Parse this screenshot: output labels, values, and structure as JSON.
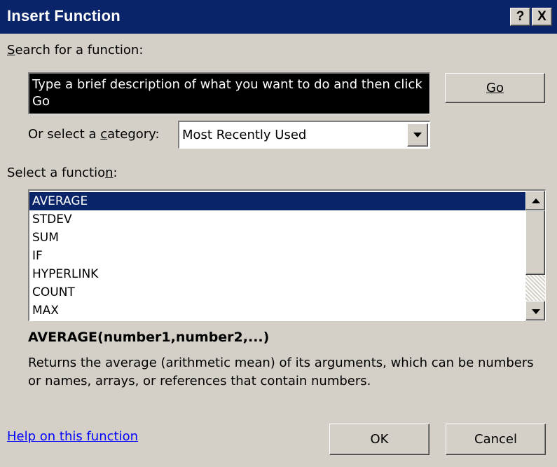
{
  "window": {
    "title": "Insert Function",
    "help_button": "?",
    "close_button": "X"
  },
  "search": {
    "label_prefix": "",
    "label_accel": "S",
    "label_rest": "earch for a function:",
    "value": "Type a brief description of what you want to do and then click Go",
    "go_label": "Go"
  },
  "category": {
    "label_prefix": "Or select a ",
    "label_accel": "c",
    "label_rest": "ategory:",
    "selected": "Most Recently Used"
  },
  "functions": {
    "label_prefix": "Select a functio",
    "label_accel": "n",
    "label_rest": ":",
    "items": [
      {
        "name": "AVERAGE"
      },
      {
        "name": "STDEV"
      },
      {
        "name": "SUM"
      },
      {
        "name": "IF"
      },
      {
        "name": "HYPERLINK"
      },
      {
        "name": "COUNT"
      },
      {
        "name": "MAX"
      }
    ],
    "selected_index": 0
  },
  "details": {
    "syntax": "AVERAGE(number1,number2,...)",
    "description": "Returns the average (arithmetic mean) of its arguments, which can be numbers or names, arrays, or references that contain numbers."
  },
  "footer": {
    "help_link": "Help on this function",
    "ok_label": "OK",
    "cancel_label": "Cancel"
  },
  "colors": {
    "face": "#d4d0c8",
    "titlebar": "#0a246a",
    "selection": "#0a246a",
    "link": "#0000ff"
  },
  "icons": [
    "help-icon",
    "close-icon",
    "dropdown-arrow-icon",
    "scroll-up-arrow-icon",
    "scroll-down-arrow-icon"
  ]
}
